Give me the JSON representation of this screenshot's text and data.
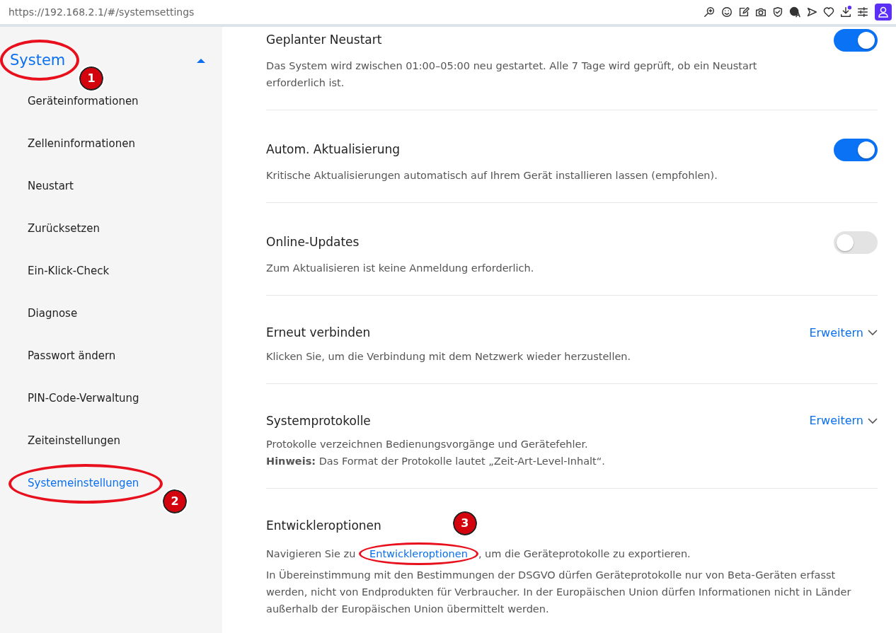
{
  "browser": {
    "url": "https://192.168.2.1/#/systemsettings"
  },
  "sidebar": {
    "group": {
      "label": "System",
      "expanded": true,
      "callout": "1"
    },
    "items": [
      {
        "label": "Geräteinformationen",
        "selected": false
      },
      {
        "label": "Zelleninformationen",
        "selected": false
      },
      {
        "label": "Neustart",
        "selected": false
      },
      {
        "label": "Zurücksetzen",
        "selected": false
      },
      {
        "label": "Ein-Klick-Check",
        "selected": false
      },
      {
        "label": "Diagnose",
        "selected": false
      },
      {
        "label": "Passwort ändern",
        "selected": false
      },
      {
        "label": "PIN-Code-Verwaltung",
        "selected": false
      },
      {
        "label": "Zeiteinstellungen",
        "selected": false
      },
      {
        "label": "Systemeinstellungen",
        "selected": true,
        "callout": "2"
      }
    ]
  },
  "settings": [
    {
      "kind": "toggle",
      "title": "Geplanter Neustart",
      "on": true,
      "lines": [
        "Das System wird zwischen 01:00–05:00 neu gestartet. Alle 7 Tage wird geprüft, ob ein Neustart erforderlich ist."
      ]
    },
    {
      "kind": "toggle",
      "title": "Autom. Aktualisierung",
      "on": true,
      "lines": [
        "Kritische Aktualisierungen automatisch auf Ihrem Gerät installieren lassen (empfohlen)."
      ]
    },
    {
      "kind": "toggle",
      "title": "Online-Updates",
      "on": false,
      "lines": [
        "Zum Aktualisieren ist keine Anmeldung erforderlich."
      ]
    },
    {
      "kind": "expand",
      "title": "Erneut verbinden",
      "action": "Erweitern",
      "lines": [
        "Klicken Sie, um die Verbindung mit dem Netzwerk wieder herzustellen."
      ]
    },
    {
      "kind": "expand",
      "title": "Systemprotokolle",
      "action": "Erweitern",
      "lines": [
        "Protokolle verzeichnen Bedienungsvorgänge und Gerätefehler.",
        "**Hinweis:** Das Format der Protokolle lautet „Zeit-Art-Level-Inhalt“."
      ]
    },
    {
      "kind": "link",
      "title": "Entwickleroptionen",
      "before": "Navigieren Sie zu ",
      "link": "Entwickleroptionen",
      "after": ", um die Geräteprotokolle zu exportieren.",
      "callout": "3",
      "lines": [
        "In Übereinstimmung mit den Bestimmungen der DSGVO dürfen Geräteprotokolle nur von Beta-Geräten erfasst werden, nicht von Endprodukten für Verbraucher. In der Europäischen Union dürfen Informationen nicht in Länder außerhalb der Europäischen Union übermittelt werden."
      ]
    }
  ]
}
